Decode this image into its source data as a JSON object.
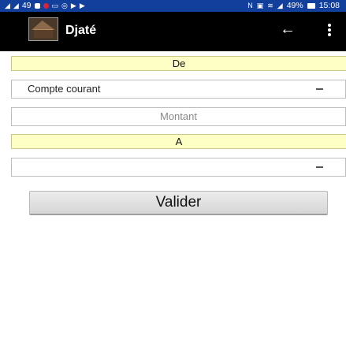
{
  "status_bar": {
    "left_text": "49",
    "battery": "49%",
    "time": "15:08",
    "icons": [
      "signal-icon",
      "signal-icon",
      "notification-icon",
      "image-icon",
      "camera-icon",
      "media-icon",
      "nfc-icon",
      "wifi-icon",
      "cell-signal-icon",
      "battery-icon"
    ]
  },
  "app_bar": {
    "title": "Djaté",
    "back_icon": "arrow-left",
    "menu_icon": "more-vertical"
  },
  "form": {
    "from_header": "De",
    "from_account": "Compte courant",
    "amount_placeholder": "Montant",
    "to_header": "A",
    "to_account": "",
    "submit_label": "Valider"
  },
  "colors": {
    "status_bar": "#123f9b",
    "app_bar": "#000000",
    "section_header": "#feffc4",
    "button": "#dedede"
  }
}
